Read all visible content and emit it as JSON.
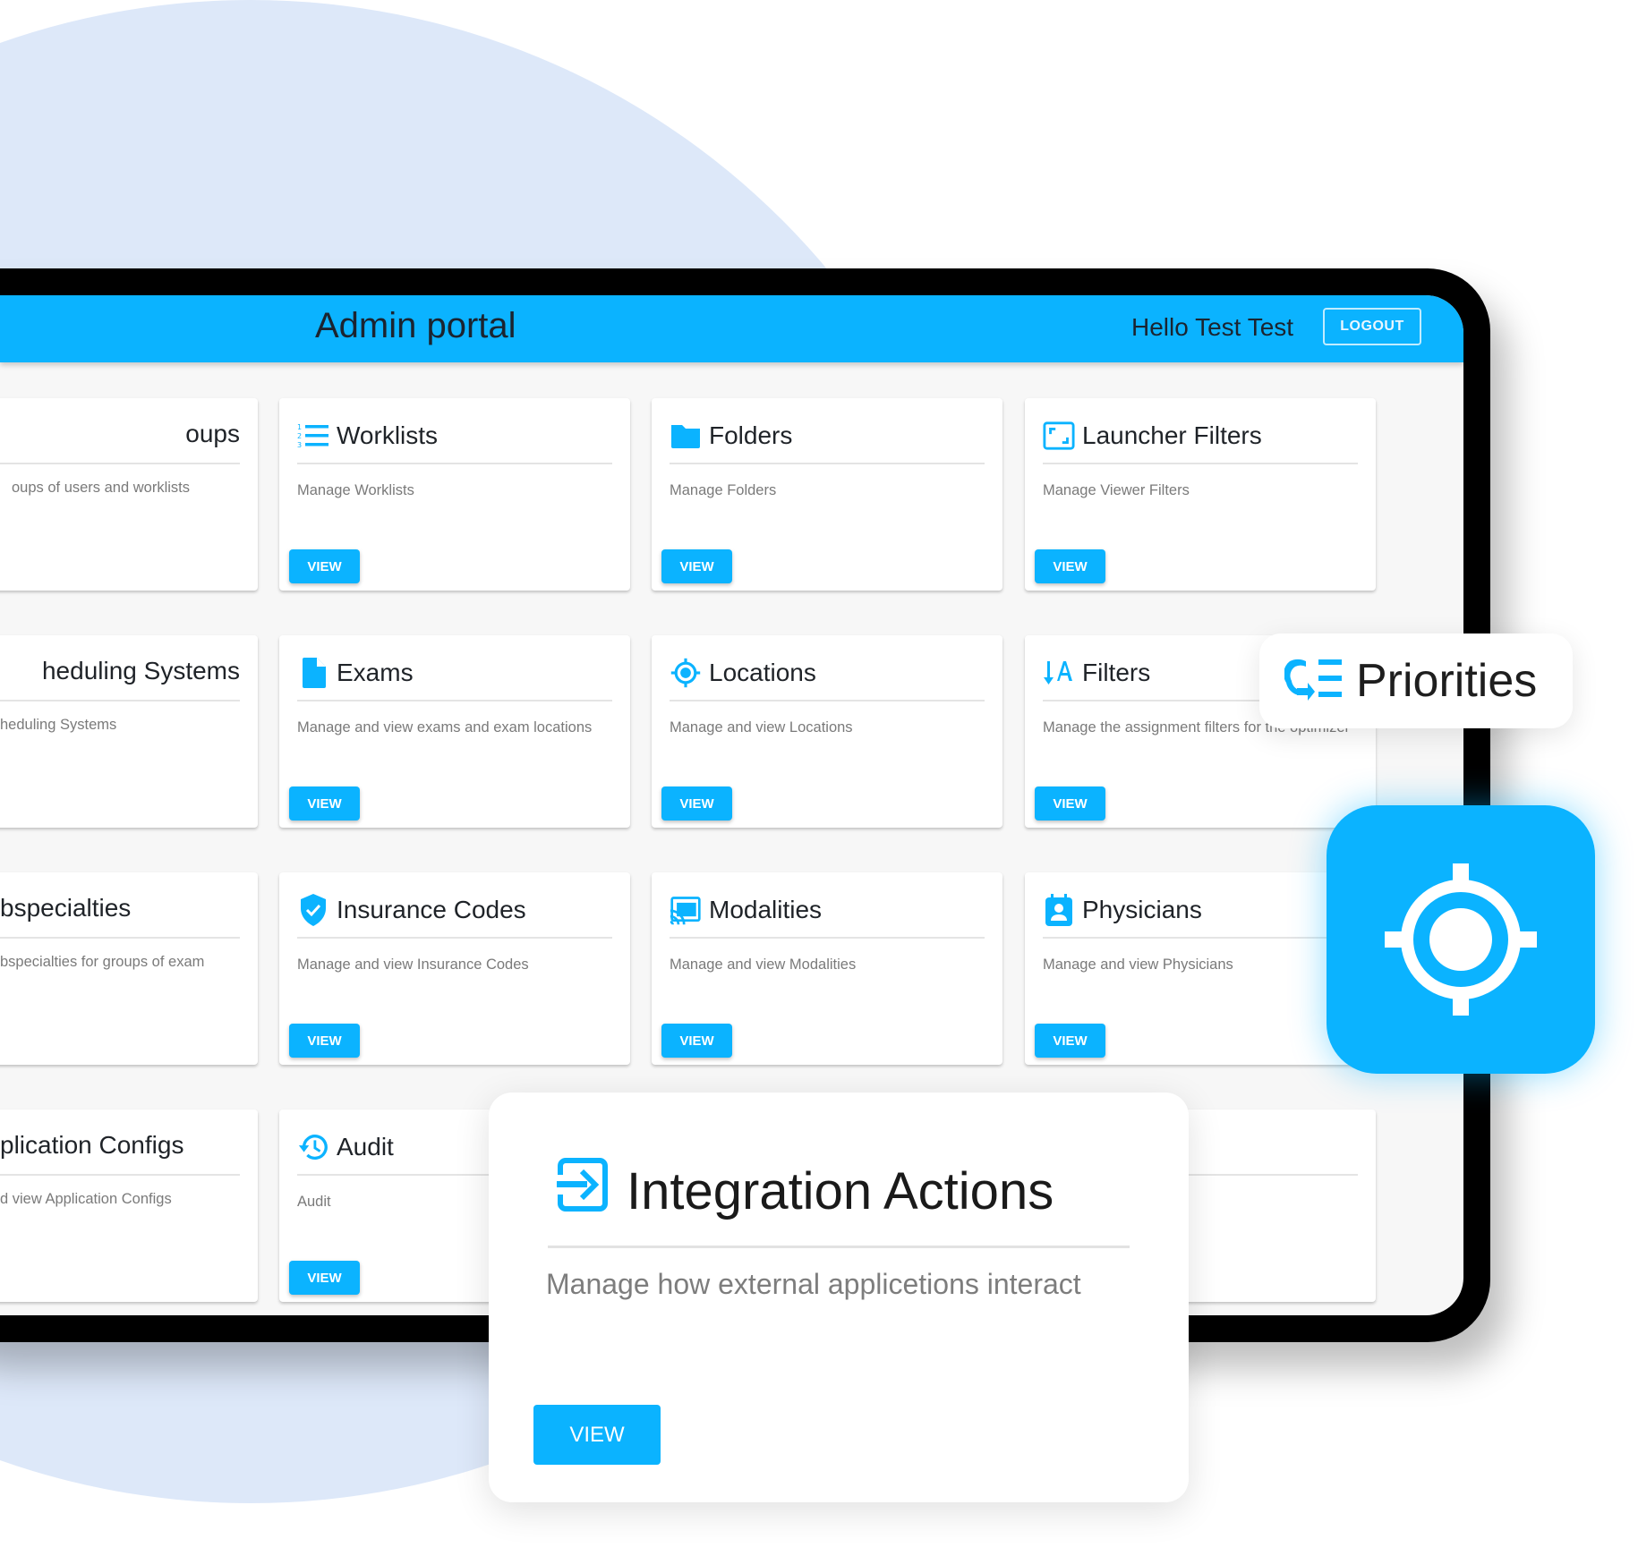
{
  "header": {
    "title": "Admin portal",
    "greeting": "Hello Test Test",
    "logout_label": "LOGOUT"
  },
  "colors": {
    "accent": "#0bb3ff",
    "background_circle": "#dde8f9",
    "frame": "#000000",
    "screen_bg": "#f7f7f7"
  },
  "cards": [
    {
      "title": "oups",
      "description": "oups of users and worklists",
      "icon": "none",
      "button": ""
    },
    {
      "title": "Worklists",
      "description": "Manage Worklists",
      "icon": "numbered-list-icon",
      "button": "VIEW"
    },
    {
      "title": "Folders",
      "description": "Manage Folders",
      "icon": "folder-icon",
      "button": "VIEW"
    },
    {
      "title": "Launcher Filters",
      "description": "Manage Viewer Filters",
      "icon": "launcher-frame-icon",
      "button": "VIEW"
    },
    {
      "title": "heduling Systems",
      "description": "heduling Systems",
      "icon": "none",
      "button": ""
    },
    {
      "title": "Exams",
      "description": "Manage and view exams and exam locations",
      "icon": "document-icon",
      "button": "VIEW"
    },
    {
      "title": "Locations",
      "description": "Manage and view Locations",
      "icon": "crosshair-icon",
      "button": "VIEW"
    },
    {
      "title": "Filters",
      "description": "Manage the assignment filters for the optimizer",
      "icon": "sort-az-icon",
      "button": "VIEW"
    },
    {
      "title": "bspecialties",
      "description": "bspecialties for groups of exam",
      "icon": "none",
      "button": ""
    },
    {
      "title": "Insurance Codes",
      "description": "Manage and view Insurance Codes",
      "icon": "shield-check-icon",
      "button": "VIEW"
    },
    {
      "title": "Modalities",
      "description": "Manage and view Modalities",
      "icon": "cast-icon",
      "button": "VIEW"
    },
    {
      "title": "Physicians",
      "description": "Manage and view Physicians",
      "icon": "badge-person-icon",
      "button": "VIEW"
    },
    {
      "title": "plication Configs",
      "description": "d view Application Configs",
      "icon": "none",
      "button": ""
    },
    {
      "title": "Audit",
      "description": "Audit",
      "icon": "history-icon",
      "button": "VIEW"
    }
  ],
  "featured_card": {
    "title": "Integration Actions",
    "description": "Manage how external applicetions interact",
    "button": "VIEW",
    "icon": "login-arrow-icon"
  },
  "priorities_badge": {
    "label": "Priorities",
    "icon": "priority-sort-icon"
  },
  "app_icon": {
    "icon": "crosshair-icon"
  }
}
